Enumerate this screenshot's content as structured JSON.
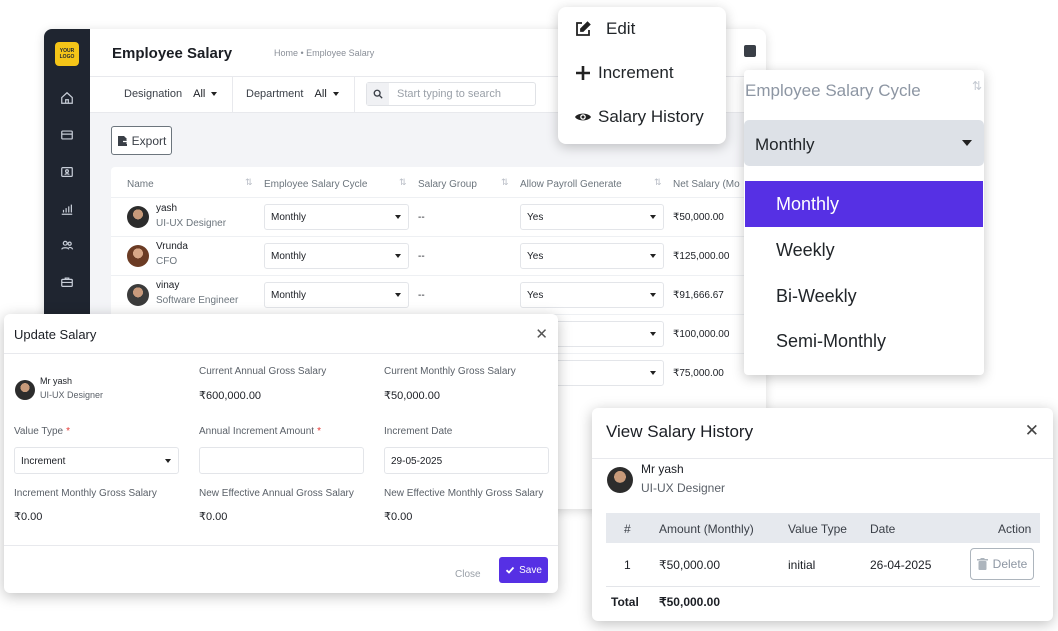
{
  "header": {
    "logo_text": "YOUR LOGO",
    "title": "Employee Salary",
    "breadcrumb": "Home • Employee Salary"
  },
  "filters": {
    "designation_label": "Designation",
    "designation_value": "All",
    "department_label": "Department",
    "department_value": "All",
    "search_placeholder": "Start typing to search"
  },
  "toolbar": {
    "export_label": "Export"
  },
  "table": {
    "columns": [
      "Name",
      "Employee Salary Cycle",
      "Salary Group",
      "Allow Payroll Generate",
      "Net Salary (Mo"
    ],
    "rows": [
      {
        "name": "yash",
        "role": "UI-UX Designer",
        "cycle": "Monthly",
        "group": "--",
        "payroll": "Yes",
        "net": "₹50,000.00"
      },
      {
        "name": "Vrunda",
        "role": "CFO",
        "cycle": "Monthly",
        "group": "--",
        "payroll": "Yes",
        "net": "₹125,000.00"
      },
      {
        "name": "vinay",
        "role": "Software Engineer",
        "cycle": "Monthly",
        "group": "--",
        "payroll": "Yes",
        "net": "₹91,666.67"
      }
    ],
    "hidden_net": [
      "₹100,000.00",
      "₹75,000.00"
    ]
  },
  "action_menu": {
    "edit": "Edit",
    "increment": "Increment",
    "history": "Salary History"
  },
  "cycle_dropdown": {
    "title": "Employee Salary Cycle",
    "selected": "Monthly",
    "options": [
      "Monthly",
      "Weekly",
      "Bi-Weekly",
      "Semi-Monthly"
    ]
  },
  "update_salary": {
    "title": "Update Salary",
    "employee_name": "Mr yash",
    "employee_role": "UI-UX Designer",
    "current_annual_label": "Current Annual Gross Salary",
    "current_annual_value": "₹600,000.00",
    "current_monthly_label": "Current Monthly Gross Salary",
    "current_monthly_value": "₹50,000.00",
    "value_type_label": "Value Type",
    "value_type_value": "Increment",
    "annual_increment_label": "Annual Increment Amount",
    "annual_increment_value": "",
    "increment_date_label": "Increment Date",
    "increment_date_value": "29-05-2025",
    "inc_monthly_label": "Increment Monthly Gross Salary",
    "inc_monthly_value": "₹0.00",
    "new_annual_label": "New Effective Annual Gross Salary",
    "new_annual_value": "₹0.00",
    "new_monthly_label": "New Effective Monthly Gross Salary",
    "new_monthly_value": "₹0.00",
    "close_label": "Close",
    "save_label": "Save"
  },
  "history": {
    "title": "View Salary History",
    "employee_name": "Mr yash",
    "employee_role": "UI-UX Designer",
    "columns": [
      "#",
      "Amount (Monthly)",
      "Value Type",
      "Date",
      "Action"
    ],
    "rows": [
      {
        "index": "1",
        "amount": "₹50,000.00",
        "type": "initial",
        "date": "26-04-2025",
        "action": "Delete"
      }
    ],
    "total_label": "Total",
    "total_value": "₹50,000.00"
  },
  "colors": {
    "accent": "#5630e4",
    "sidebar": "#1f2530",
    "logo": "#f5c518"
  }
}
